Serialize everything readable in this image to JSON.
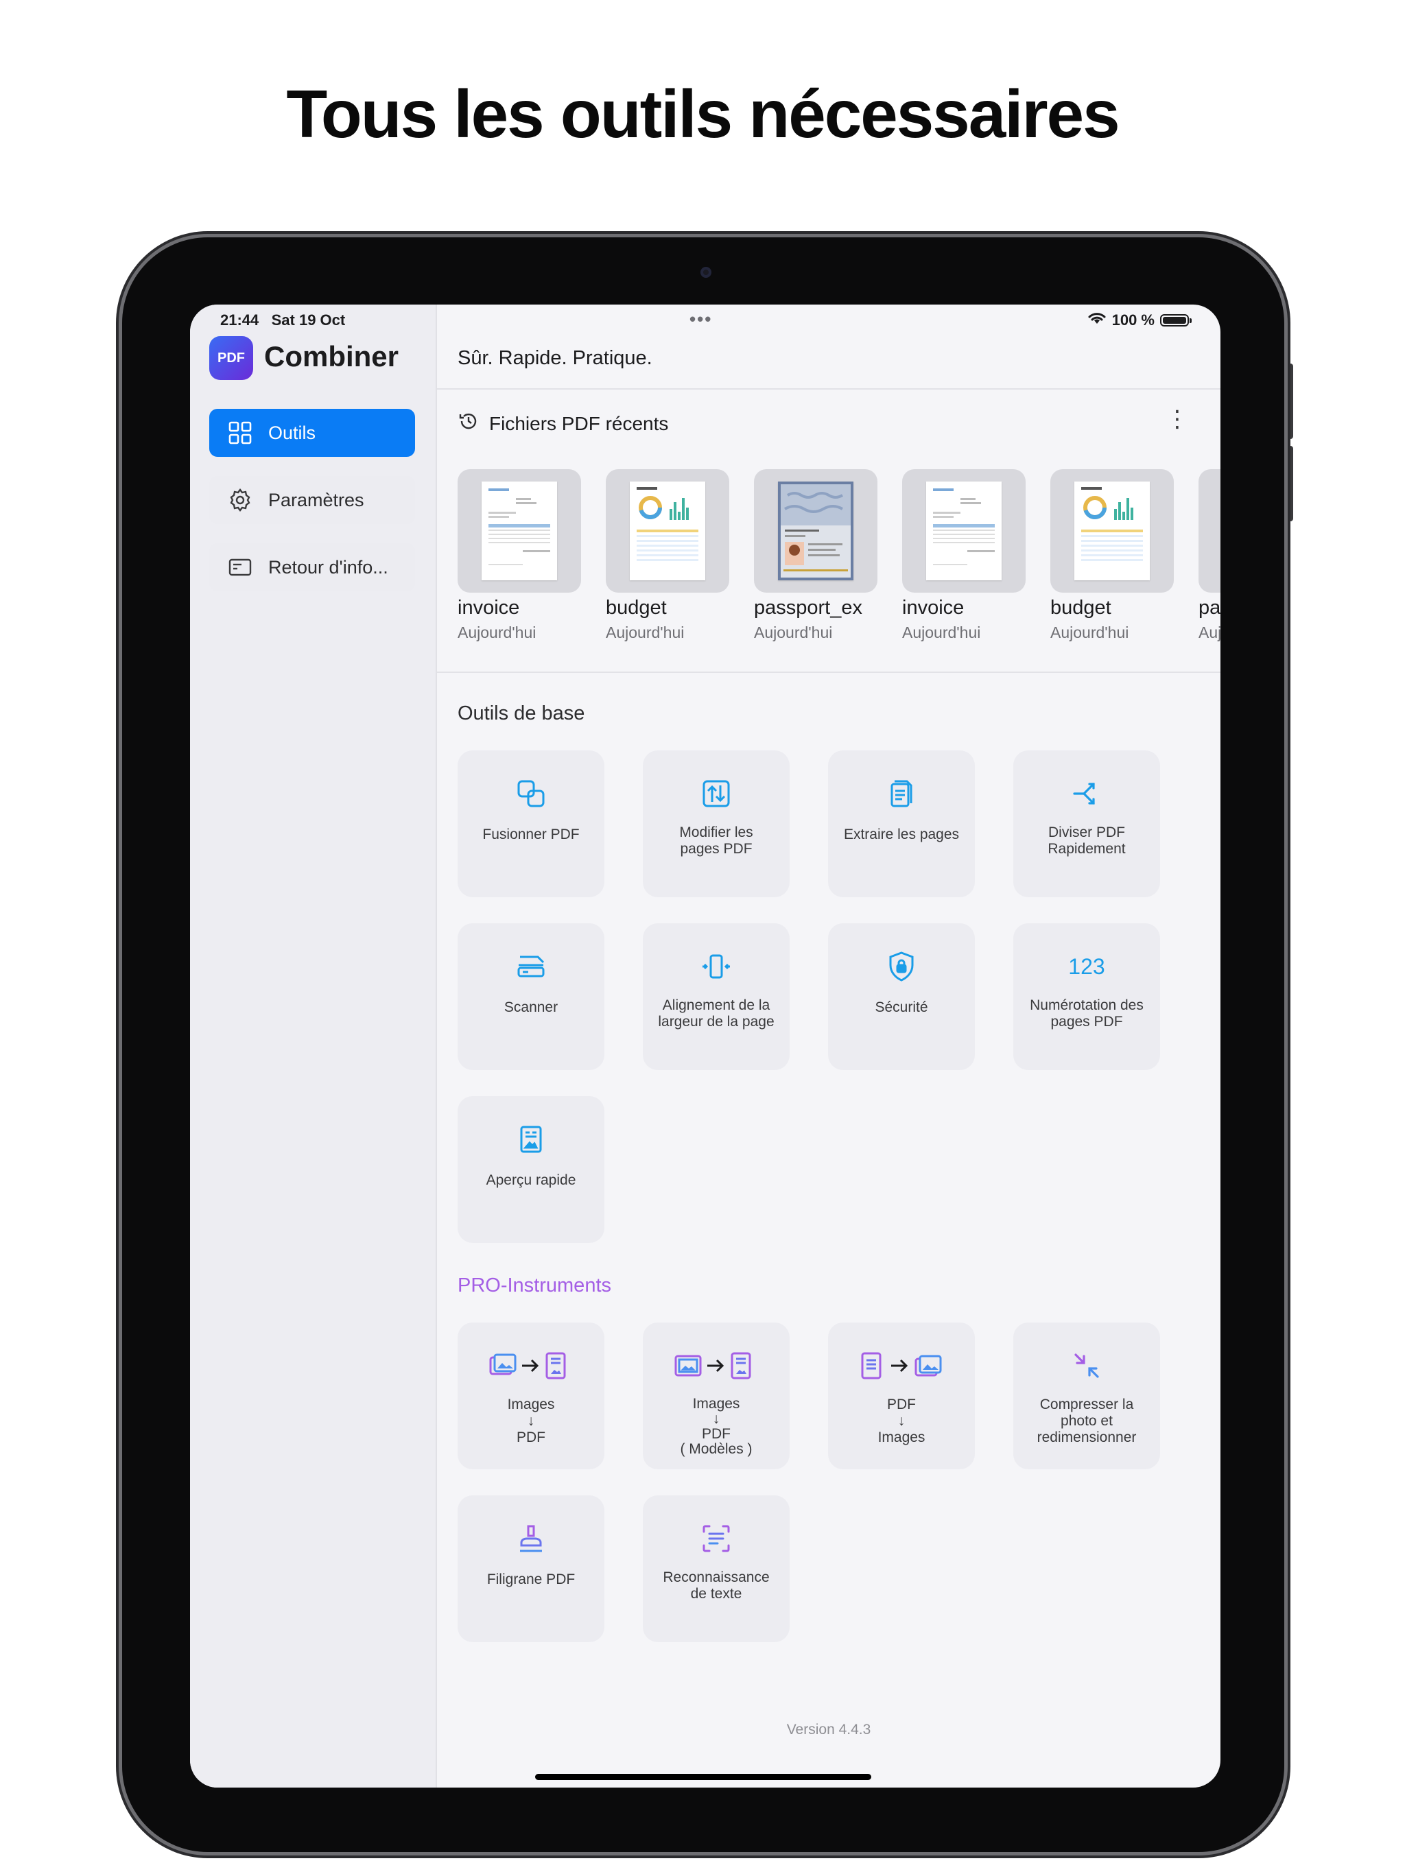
{
  "headline": "Tous les outils nécessaires",
  "status": {
    "time": "21:44",
    "date": "Sat 19 Oct",
    "battery": "100 %"
  },
  "app": {
    "logo_text": "PDF",
    "name": "Combiner",
    "tagline": "Sûr. Rapide. Pratique."
  },
  "sidebar": {
    "items": [
      {
        "label": "Outils",
        "icon": "grid-icon",
        "active": true
      },
      {
        "label": "Paramètres",
        "icon": "gear-icon",
        "active": false
      },
      {
        "label": "Retour d'info...",
        "icon": "feedback-icon",
        "active": false
      }
    ]
  },
  "recent": {
    "title": "Fichiers PDF récents",
    "files": [
      {
        "name": "invoice",
        "date": "Aujourd'hui"
      },
      {
        "name": "budget",
        "date": "Aujourd'hui"
      },
      {
        "name": "passport_ex",
        "date": "Aujourd'hui"
      },
      {
        "name": "invoice",
        "date": "Aujourd'hui"
      },
      {
        "name": "budget",
        "date": "Aujourd'hui"
      },
      {
        "name": "pa",
        "date": "Auj"
      }
    ]
  },
  "basic": {
    "title": "Outils de base",
    "tiles": [
      {
        "label": "Fusionner PDF"
      },
      {
        "label": "Modifier les\npages PDF"
      },
      {
        "label": "Extraire les pages"
      },
      {
        "label": "Diviser PDF\nRapidement"
      },
      {
        "label": "Scanner"
      },
      {
        "label": "Alignement de la\nlargeur de la page"
      },
      {
        "label": "Sécurité"
      },
      {
        "label": "Numérotation des\npages PDF",
        "icon_text": "123"
      },
      {
        "label": "Aperçu rapide"
      }
    ]
  },
  "pro": {
    "title": "PRO-Instruments",
    "tiles": [
      {
        "label": "Images\n↓\nPDF"
      },
      {
        "label": "Images\n↓\nPDF\n( Modèles )"
      },
      {
        "label": "PDF\n↓\nImages"
      },
      {
        "label": "Compresser la\nphoto et\nredimensionner"
      },
      {
        "label": "Filigrane PDF"
      },
      {
        "label": "Reconnaissance\nde texte"
      }
    ]
  },
  "version": "Version 4.4.3",
  "colors": {
    "accent": "#0a7cf5",
    "pro": "#a45ee5",
    "icon": "#1a9de8"
  }
}
